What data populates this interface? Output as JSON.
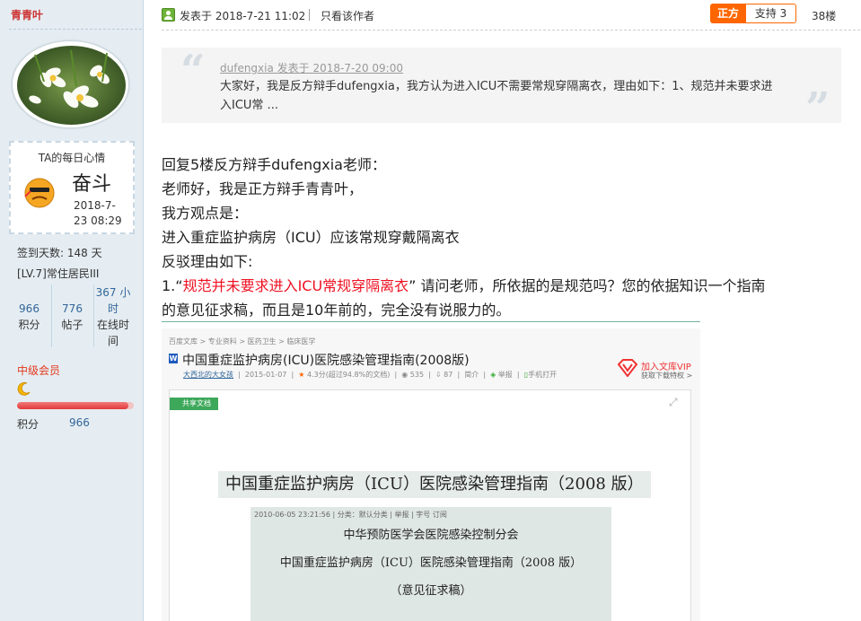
{
  "user": {
    "name": "青青叶",
    "mood_title": "TA的每日心情",
    "mood_text": "奋斗",
    "mood_date": "2018-7-23 08:29",
    "signin": "签到天数: 148 天",
    "rank": "[LV.7]常住居民III",
    "stats": [
      {
        "value": "966",
        "label": "积分"
      },
      {
        "value": "776",
        "label": "帖子"
      },
      {
        "value": "367 小时",
        "label": "在线时间"
      }
    ],
    "member_level": "中级会员",
    "level_progress": 0.95,
    "points_label": "积分",
    "points_value": "966"
  },
  "post": {
    "time": "发表于 2018-7-21 11:02",
    "only_author": "只看该作者",
    "side": "正方",
    "support": "支持 3",
    "floor": "38楼",
    "quote": {
      "author": "dufengxia 发表于 2018-7-20 09:00",
      "text": "大家好，我是反方辩手dufengxia，我方认为进入ICU不需要常规穿隔离衣，理由如下：1、规范并未要求进入ICU常 ..."
    },
    "lines": [
      "回复5楼反方辩手dufengxia老师：",
      "老师好，我是正方辩手青青叶，",
      "我方观点是：",
      "进入重症监护病房（ICU）应该常规穿戴隔离衣",
      "反驳理由如下:"
    ],
    "point1_prefix": "1.“",
    "point1_red": "规范并未要求进入ICU常规穿隔离衣",
    "point1_rest": "” 请问老师，所依据的是规范吗？您的依据知识一个指南",
    "point1_line2": "的意见征求稿，而且是10年前的，完全没有说服力的。"
  },
  "doc": {
    "breadcrumb": "百度文库 > 专业资料 > 医药卫生 > 临床医学",
    "title": "中国重症监护病房(ICU)医院感染管理指南(2008版)",
    "uploader": "大西北的大女孩",
    "date": "2015-01-07",
    "rating": "4.3分(超过94.8%的文档)",
    "views": "535",
    "downloads": "87",
    "share": "简介",
    "report": "举报",
    "mobile": "手机打开",
    "vip": "加入文库VIP",
    "vip_sub": "获取下载特权 >",
    "shared_tag": "共享文档",
    "heading": "中国重症监护病房（ICU）医院感染管理指南（2008 版）",
    "box_meta": "2010-06-05 23:21:56 | 分类：默认分类 | 举报 | 字号 订阅",
    "box_lines": [
      "中华预防医学会医院感染控制分会",
      "中国重症监护病房（ICU）医院感染管理指南（2008 版）",
      "（意见征求稿）"
    ]
  }
}
